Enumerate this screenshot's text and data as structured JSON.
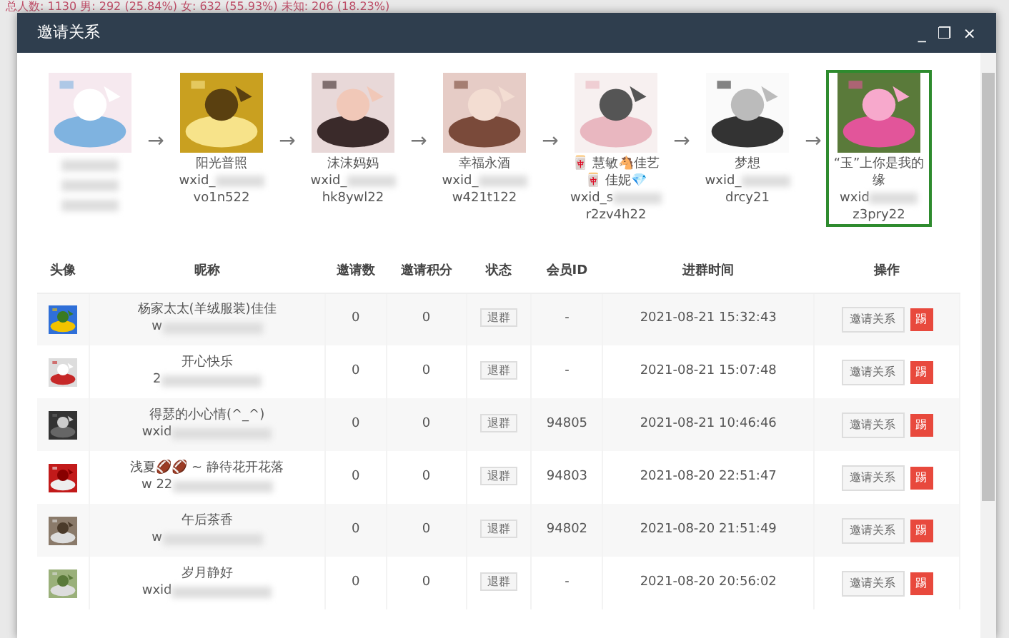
{
  "background_header": "总人数: 1130  男: 292 (25.84%)  女: 632 (55.93%)  未知: 206 (18.23%)",
  "window": {
    "title": "邀请关系",
    "controls": [
      "_",
      "❐",
      "×"
    ]
  },
  "chain": [
    {
      "selected": false,
      "blurred": true
    },
    {
      "name": "阳光普照",
      "wxid": "wxid_",
      "suffix": "vo1n522",
      "selected": false,
      "blurred": false
    },
    {
      "name": "沫沫妈妈",
      "wxid": "wxid_",
      "suffix": "hk8ywl22",
      "selected": false,
      "blurred": false
    },
    {
      "name": "幸福永酒",
      "wxid": "wxid_",
      "suffix": "w421t122",
      "selected": false,
      "blurred": false
    },
    {
      "name": "🀄 慧敏🐴佳艺🀄 佳妮💎",
      "wxid": "wxid_s",
      "suffix": "r2zv4h22",
      "selected": false,
      "blurred": false
    },
    {
      "name": "梦想",
      "wxid": "wxid_",
      "suffix": "drcy21",
      "selected": false,
      "blurred": false
    },
    {
      "name": "“玉”上你是我的缘",
      "wxid": "wxid",
      "suffix": "z3pry22",
      "selected": true,
      "blurred": false
    }
  ],
  "arrow": "→",
  "table": {
    "columns": [
      "头像",
      "昵称",
      "邀请数",
      "邀请积分",
      "状态",
      "会员ID",
      "进群时间",
      "操作"
    ],
    "rows": [
      {
        "nickname": "杨家太太(羊绒服装)佳佳",
        "wxid": "w",
        "invites": "0",
        "points": "0",
        "status": "退群",
        "member_id": "-",
        "joined": "2021-08-21 15:32:43",
        "action": "邀请关系",
        "kick": "踢"
      },
      {
        "nickname": "开心快乐",
        "wxid": "2",
        "invites": "0",
        "points": "0",
        "status": "退群",
        "member_id": "-",
        "joined": "2021-08-21 15:07:48",
        "action": "邀请关系",
        "kick": "踢"
      },
      {
        "nickname": "得瑟的小心情(^_^)",
        "wxid": "wxid",
        "invites": "0",
        "points": "0",
        "status": "退群",
        "member_id": "94805",
        "joined": "2021-08-21 10:46:46",
        "action": "邀请关系",
        "kick": "踢"
      },
      {
        "nickname": "浅夏🏈🏈 ~ 静待花开花落",
        "wxid": "w 22",
        "invites": "0",
        "points": "0",
        "status": "退群",
        "member_id": "94803",
        "joined": "2021-08-20 22:51:47",
        "action": "邀请关系",
        "kick": "踢"
      },
      {
        "nickname": "午后茶香",
        "wxid": "w",
        "invites": "0",
        "points": "0",
        "status": "退群",
        "member_id": "94802",
        "joined": "2021-08-20 21:51:49",
        "action": "邀请关系",
        "kick": "踢"
      },
      {
        "nickname": "岁月静好",
        "wxid": "wxid",
        "invites": "0",
        "points": "0",
        "status": "退群",
        "member_id": "-",
        "joined": "2021-08-20 20:56:02",
        "action": "邀请关系",
        "kick": "踢"
      }
    ]
  }
}
